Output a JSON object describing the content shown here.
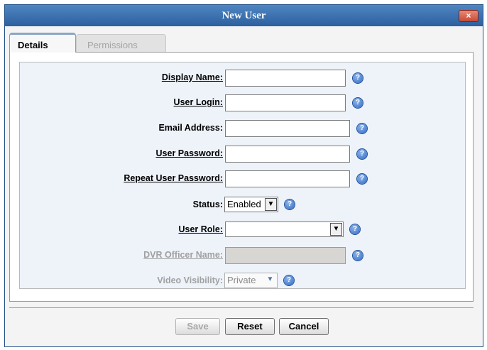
{
  "dialog": {
    "title": "New User",
    "close_label": "×"
  },
  "tabs": [
    {
      "label": "Details",
      "active": true
    },
    {
      "label": "Permissions",
      "active": false
    }
  ],
  "form": {
    "display_name": {
      "label": "Display Name:",
      "value": ""
    },
    "user_login": {
      "label": "User Login:",
      "value": ""
    },
    "email_address": {
      "label": "Email Address:",
      "value": ""
    },
    "user_password": {
      "label": "User Password:",
      "value": ""
    },
    "repeat_user_password": {
      "label": "Repeat User Password:",
      "value": ""
    },
    "status": {
      "label": "Status:",
      "value": "Enabled"
    },
    "user_role": {
      "label": "User Role:",
      "value": ""
    },
    "dvr_officer_name": {
      "label": "DVR Officer Name:",
      "value": "",
      "disabled": true
    },
    "video_visibility": {
      "label": "Video Visibility:",
      "value": "Private",
      "disabled": true
    }
  },
  "help_icon": "question-mark",
  "buttons": {
    "save": "Save",
    "reset": "Reset",
    "cancel": "Cancel"
  },
  "colors": {
    "titlebar": "#2c5f9e",
    "form_background": "#eef3fa",
    "close": "#c84a34"
  }
}
